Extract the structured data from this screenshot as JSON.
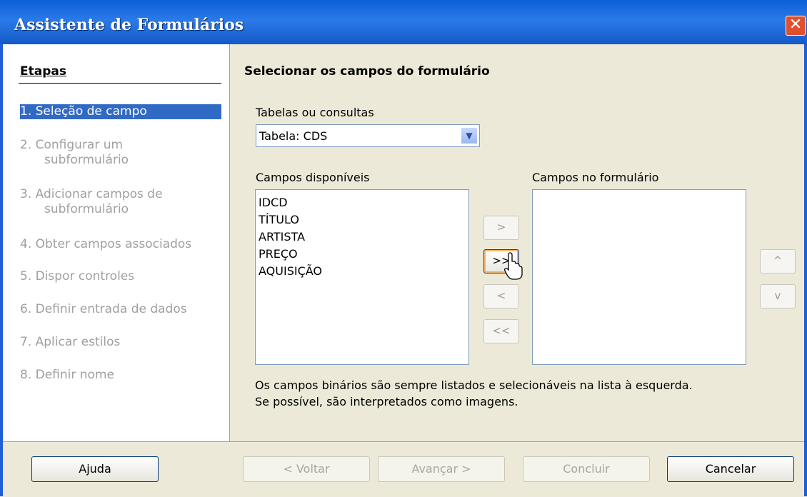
{
  "window": {
    "title": "Assistente de Formulários",
    "close_glyph": "✕"
  },
  "sidebar": {
    "header": "Etapas",
    "steps": [
      {
        "label_line1": "1. Seleção de campo",
        "label_line2": ""
      },
      {
        "label_line1": "2. Configurar um",
        "label_line2": "subformulário"
      },
      {
        "label_line1": "3. Adicionar campos de",
        "label_line2": "subformulário"
      },
      {
        "label_line1": "4. Obter campos associados",
        "label_line2": ""
      },
      {
        "label_line1": "5. Dispor controles",
        "label_line2": ""
      },
      {
        "label_line1": "6. Definir entrada de dados",
        "label_line2": ""
      },
      {
        "label_line1": "7. Aplicar estilos",
        "label_line2": ""
      },
      {
        "label_line1": "8. Definir nome",
        "label_line2": ""
      }
    ]
  },
  "main": {
    "heading": "Selecionar os campos do formulário",
    "tables_label": "Tabelas ou consultas",
    "tables_selected": "Tabela: CDS",
    "available_label": "Campos disponíveis",
    "form_fields_label": "Campos no formulário",
    "available_fields": [
      "IDCD",
      "TÍTULO",
      "ARTISTA",
      "PREÇO",
      "AQUISIÇÃO"
    ],
    "move_buttons": {
      "add_one": ">",
      "add_all": ">>",
      "remove_one": "<",
      "remove_all": "<<"
    },
    "order_buttons": {
      "up": "^",
      "down": "v"
    },
    "note_line1": "Os campos binários são sempre listados e selecionáveis na lista à esquerda.",
    "note_line2": "Se possível, são interpretados como imagens."
  },
  "footer": {
    "help": "Ajuda",
    "back": "< Voltar",
    "next": "Avançar >",
    "finish": "Concluir",
    "cancel": "Cancelar"
  }
}
